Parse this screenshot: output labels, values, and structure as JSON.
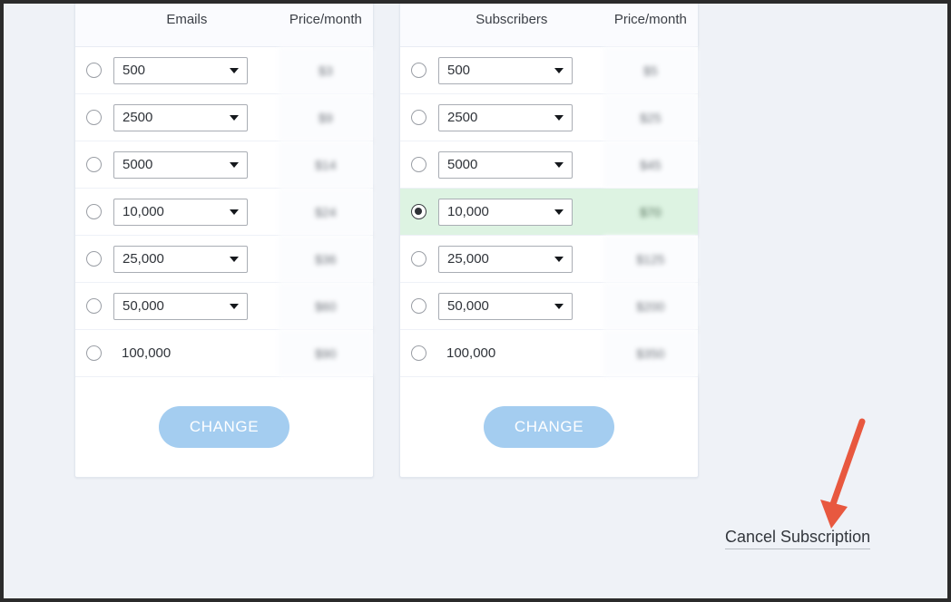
{
  "page": {
    "background_color": "#eff2f7",
    "panel_background": "#ffffff",
    "selected_row_color": "#ddf3e2",
    "button_color": "#a4cdf0",
    "arrow_color": "#e8583f"
  },
  "panels": [
    {
      "id": "emails",
      "headers": {
        "quantity": "Emails",
        "price": "Price/month"
      },
      "rows": [
        {
          "quantity": "500",
          "price": "$3",
          "selected": false,
          "has_dropdown": true
        },
        {
          "quantity": "2500",
          "price": "$9",
          "selected": false,
          "has_dropdown": true
        },
        {
          "quantity": "5000",
          "price": "$14",
          "selected": false,
          "has_dropdown": true
        },
        {
          "quantity": "10,000",
          "price": "$24",
          "selected": false,
          "has_dropdown": true
        },
        {
          "quantity": "25,000",
          "price": "$36",
          "selected": false,
          "has_dropdown": true
        },
        {
          "quantity": "50,000",
          "price": "$60",
          "selected": false,
          "has_dropdown": true
        },
        {
          "quantity": "100,000",
          "price": "$90",
          "selected": false,
          "has_dropdown": false
        }
      ],
      "change_button_label": "CHANGE"
    },
    {
      "id": "subscribers",
      "headers": {
        "quantity": "Subscribers",
        "price": "Price/month"
      },
      "rows": [
        {
          "quantity": "500",
          "price": "$5",
          "selected": false,
          "has_dropdown": true
        },
        {
          "quantity": "2500",
          "price": "$25",
          "selected": false,
          "has_dropdown": true
        },
        {
          "quantity": "5000",
          "price": "$45",
          "selected": false,
          "has_dropdown": true
        },
        {
          "quantity": "10,000",
          "price": "$70",
          "selected": true,
          "has_dropdown": true
        },
        {
          "quantity": "25,000",
          "price": "$125",
          "selected": false,
          "has_dropdown": true
        },
        {
          "quantity": "50,000",
          "price": "$200",
          "selected": false,
          "has_dropdown": true
        },
        {
          "quantity": "100,000",
          "price": "$350",
          "selected": false,
          "has_dropdown": false
        }
      ],
      "change_button_label": "CHANGE"
    }
  ],
  "cancel": {
    "label": "Cancel Subscription",
    "annotation_icon": "down-arrow-icon"
  }
}
